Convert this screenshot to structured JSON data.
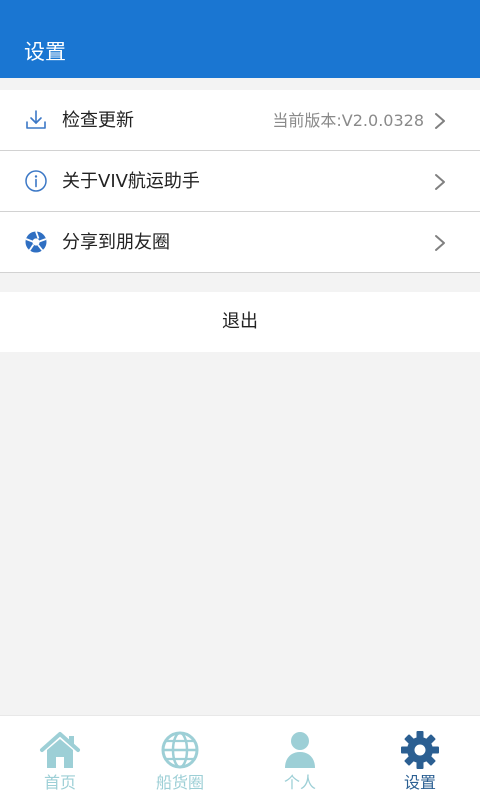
{
  "header": {
    "title": "设置"
  },
  "menu": {
    "items": [
      {
        "label": "检查更新",
        "value": "当前版本:V2.0.0328",
        "icon": "download-icon"
      },
      {
        "label": "关于VIV航运助手",
        "icon": "info-icon"
      },
      {
        "label": "分享到朋友圈",
        "icon": "moments-icon"
      }
    ]
  },
  "logout": {
    "label": "退出"
  },
  "tabbar": {
    "tabs": [
      {
        "label": "首页",
        "icon": "home-icon",
        "active": false
      },
      {
        "label": "船货圈",
        "icon": "globe-icon",
        "active": false
      },
      {
        "label": "个人",
        "icon": "person-icon",
        "active": false
      },
      {
        "label": "设置",
        "icon": "gear-icon",
        "active": true
      }
    ]
  },
  "colors": {
    "header_bg": "#1a76d2",
    "tab_inactive": "#9dcfd6",
    "tab_active": "#2b5f92",
    "icon_blue": "#3c78c6"
  }
}
